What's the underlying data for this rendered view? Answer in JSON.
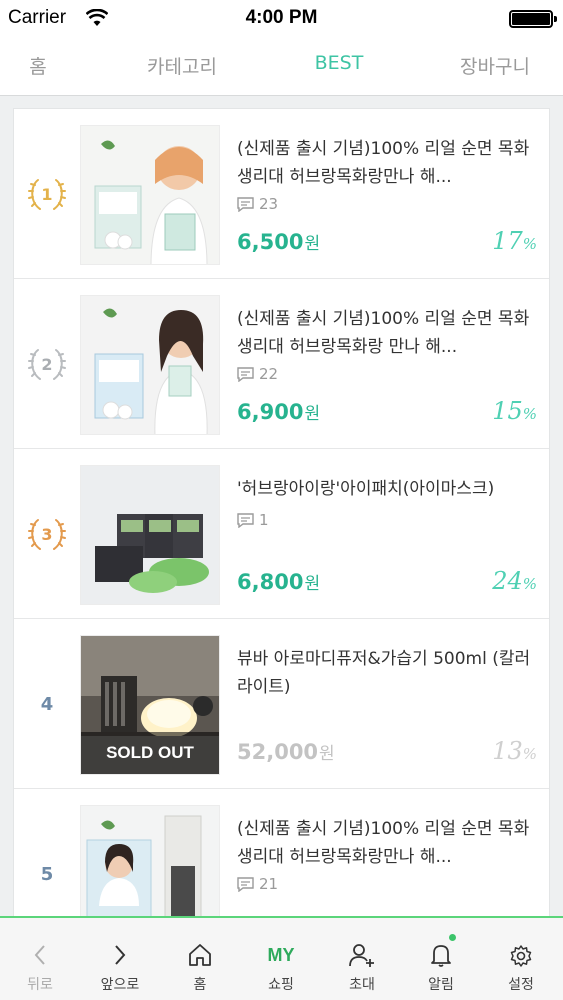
{
  "status_bar": {
    "carrier": "Carrier",
    "time": "4:00 PM"
  },
  "tabs": [
    {
      "label": "홈"
    },
    {
      "label": "카테고리"
    },
    {
      "label": "BEST"
    },
    {
      "label": "장바구니"
    }
  ],
  "active_tab": "BEST",
  "colors": {
    "accent": "#3ec4a4",
    "price": "#27b38f",
    "nav_border": "#5bd57a"
  },
  "products": [
    {
      "rank": "1",
      "title": "(신제품 출시 기념)100% 리얼 순면 목화 생리대 허브랑목화랑만나 해...",
      "comments": "23",
      "price": "6,500",
      "currency": "원",
      "discount": "17",
      "discount_unit": "%"
    },
    {
      "rank": "2",
      "title": "(신제품 출시 기념)100% 리얼 순면 목화 생리대 허브랑목화랑 만나 해...",
      "comments": "22",
      "price": "6,900",
      "currency": "원",
      "discount": "15",
      "discount_unit": "%"
    },
    {
      "rank": "3",
      "title": "'허브랑아이랑'아이패치(아이마스크)",
      "comments": "1",
      "price": "6,800",
      "currency": "원",
      "discount": "24",
      "discount_unit": "%"
    },
    {
      "rank": "4",
      "title": "뷰바 아로마디퓨저&가습기 500ml (칼러라이트)",
      "comments": "",
      "price": "52,000",
      "currency": "원",
      "discount": "13",
      "discount_unit": "%",
      "sold_out_label": "SOLD OUT"
    },
    {
      "rank": "5",
      "title": "(신제품 출시 기념)100% 리얼 순면 목화 생리대 허브랑목화랑만나 해...",
      "comments": "21",
      "price": "",
      "currency": "",
      "discount": "",
      "discount_unit": ""
    }
  ],
  "bottom_nav": [
    {
      "label": "뒤로",
      "icon": "back-chevron-icon"
    },
    {
      "label": "앞으로",
      "icon": "forward-chevron-icon"
    },
    {
      "label": "홈",
      "icon": "home-icon"
    },
    {
      "label": "쇼핑",
      "icon": "my-text-icon",
      "icon_text": "MY"
    },
    {
      "label": "초대",
      "icon": "add-person-icon"
    },
    {
      "label": "알림",
      "icon": "bell-icon"
    },
    {
      "label": "설정",
      "icon": "gear-icon"
    }
  ]
}
